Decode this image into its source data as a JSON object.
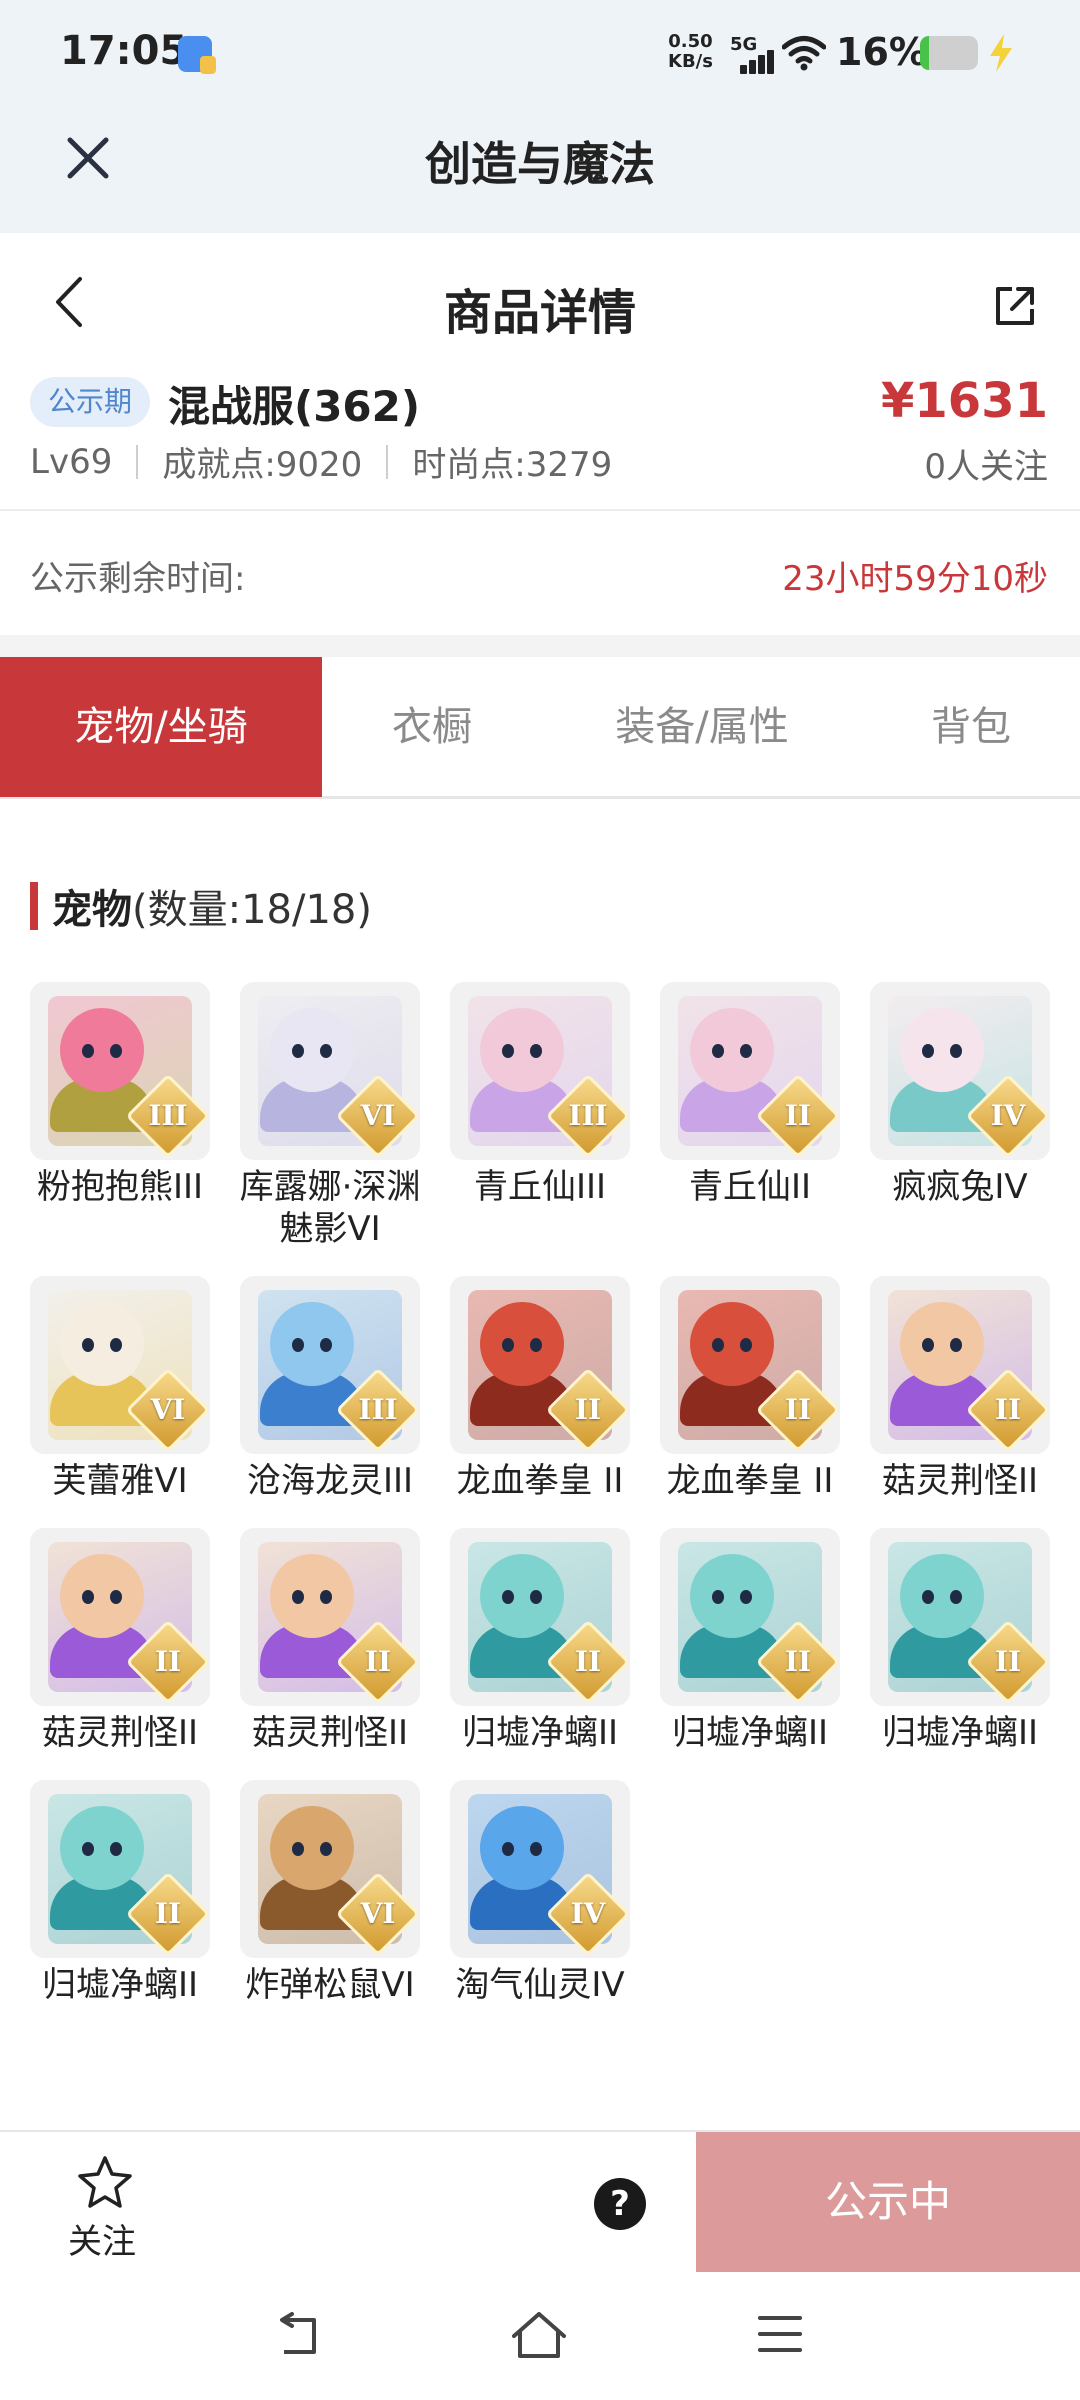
{
  "status_bar": {
    "time": "17:05",
    "net_speed_value": "0.50",
    "net_speed_unit": "KB/s",
    "network_type": "5G",
    "battery_percent": "16%",
    "battery_level": 0.16,
    "icons": [
      "app-notification-icon",
      "signal-icon",
      "wifi-icon",
      "battery-icon",
      "charging-icon"
    ]
  },
  "app_header": {
    "title": "创造与魔法",
    "close_icon": "close-icon"
  },
  "page_header": {
    "title": "商品详情",
    "back_icon": "back-icon",
    "share_icon": "share-icon"
  },
  "product": {
    "badge": "公示期",
    "server": "混战服(362)",
    "price": "¥1631",
    "level": "Lv69",
    "achievement": "成就点:9020",
    "fashion": "时尚点:3279",
    "followers": "0人关注"
  },
  "countdown": {
    "label": "公示剩余时间:",
    "value": "23小时59分10秒"
  },
  "tabs": [
    {
      "label": "宠物/坐骑",
      "active": true
    },
    {
      "label": "衣橱",
      "active": false
    },
    {
      "label": "装备/属性",
      "active": false
    },
    {
      "label": "背包",
      "active": false
    }
  ],
  "pets_section": {
    "title": "宠物",
    "count": "(数量:18/18)"
  },
  "pets": [
    {
      "name": "粉抱抱熊III",
      "rank": "III",
      "colors": [
        "#f07a9a",
        "#b0a040"
      ]
    },
    {
      "name": "库露娜·深渊魅影VI",
      "rank": "VI",
      "colors": [
        "#e8e6f2",
        "#b7b5e0"
      ]
    },
    {
      "name": "青丘仙III",
      "rank": "III",
      "colors": [
        "#f2c9d9",
        "#c9a4e6"
      ]
    },
    {
      "name": "青丘仙II",
      "rank": "II",
      "colors": [
        "#f2c9d9",
        "#c9a4e6"
      ]
    },
    {
      "name": "疯疯兔IV",
      "rank": "IV",
      "colors": [
        "#f6e4ec",
        "#79c9c9"
      ]
    },
    {
      "name": "芙蕾雅VI",
      "rank": "VI",
      "colors": [
        "#f5eee0",
        "#e6c45a"
      ]
    },
    {
      "name": "沧海龙灵III",
      "rank": "III",
      "colors": [
        "#8fc7ee",
        "#3d7fcf"
      ]
    },
    {
      "name": "龙血拳皇 II",
      "rank": "II",
      "colors": [
        "#d8503c",
        "#8e2b1f"
      ]
    },
    {
      "name": "龙血拳皇 II",
      "rank": "II",
      "colors": [
        "#d8503c",
        "#8e2b1f"
      ]
    },
    {
      "name": "菇灵荆怪II",
      "rank": "II",
      "colors": [
        "#f2c7a4",
        "#9b5bd8"
      ]
    },
    {
      "name": "菇灵荆怪II",
      "rank": "II",
      "colors": [
        "#f2c7a4",
        "#9b5bd8"
      ]
    },
    {
      "name": "菇灵荆怪II",
      "rank": "II",
      "colors": [
        "#f2c7a4",
        "#9b5bd8"
      ]
    },
    {
      "name": "归墟净螭II",
      "rank": "II",
      "colors": [
        "#7fd3cf",
        "#2f9aa0"
      ]
    },
    {
      "name": "归墟净螭II",
      "rank": "II",
      "colors": [
        "#7fd3cf",
        "#2f9aa0"
      ]
    },
    {
      "name": "归墟净螭II",
      "rank": "II",
      "colors": [
        "#7fd3cf",
        "#2f9aa0"
      ]
    },
    {
      "name": "归墟净螭II",
      "rank": "II",
      "colors": [
        "#7fd3cf",
        "#2f9aa0"
      ]
    },
    {
      "name": "炸弹松鼠VI",
      "rank": "VI",
      "colors": [
        "#d9a66e",
        "#8a5a2c"
      ]
    },
    {
      "name": "淘气仙灵IV",
      "rank": "IV",
      "colors": [
        "#5aa6ea",
        "#2a6fc0"
      ]
    }
  ],
  "bottom_bar": {
    "follow_label": "关注",
    "help_symbol": "?",
    "action_label": "公示中"
  },
  "colors": {
    "accent_red": "#c8373a",
    "badge_blue": "#4f86cc",
    "disabled_button": "#dd9a9b",
    "header_bg": "#eef3f7"
  }
}
